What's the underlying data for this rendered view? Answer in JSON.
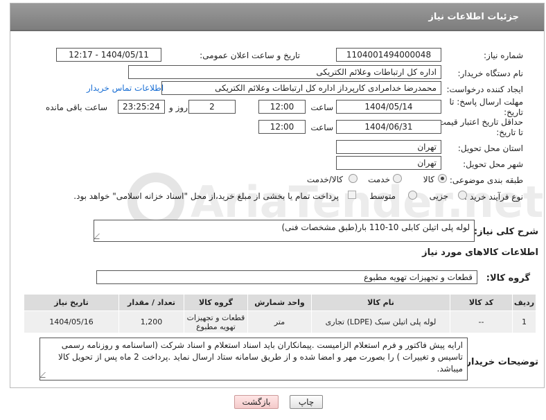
{
  "header": {
    "title": "جزئیات اطلاعات نیاز"
  },
  "fields": {
    "need_number_label": "شماره نیاز:",
    "need_number": "1104001494000048",
    "announce_label": "تاریخ و ساعت اعلان عمومی:",
    "announce_value": "1404/05/11 - 12:17",
    "buyer_org_label": "نام دستگاه خریدار:",
    "buyer_org": "اداره کل ارتباطات وعلائم الکتریکی",
    "requester_label": "ایجاد کننده درخواست:",
    "requester": "محمدرضا خدامرادی کارپرداز اداره کل ارتباطات وعلائم الکتریکی",
    "contact_link": "اطلاعات تماس خریدار",
    "reply_deadline_label_1": "مهلت ارسال پاسخ: تا",
    "reply_deadline_label_2": "تاریخ:",
    "reply_date": "1404/05/14",
    "time_label": "ساعت",
    "reply_time": "12:00",
    "days_value": "2",
    "days_label": "روز و",
    "remaining_time": "23:25:24",
    "remaining_label": "ساعت باقی مانده",
    "price_validity_label_1": "حداقل تاریخ اعتبار قیمت:",
    "price_validity_label_2": "تا تاریخ:",
    "price_date": "1404/06/31",
    "price_time": "12:00",
    "province_label": "استان محل تحویل:",
    "province": "تهران",
    "city_label": "شهر محل تحویل:",
    "city": "تهران",
    "category_label": "طبقه بندی موضوعی:",
    "category_options": [
      "کالا",
      "خدمت",
      "کالا/خدمت"
    ],
    "process_label": "نوع فرآیند خرید :",
    "process_options": [
      "جزیی",
      "متوسط"
    ],
    "payment_note": "پرداخت تمام یا بخشی از مبلغ خرید،از محل \"اسناد خزانه اسلامی\" خواهد بود."
  },
  "description": {
    "label": "شرح کلی نیاز:",
    "value": "لوله پلی اتیلن کابلی 10-110 بار(طبق مشخصات فنی)"
  },
  "goods_section_title": "اطلاعات کالاهای مورد نیاز",
  "goods_group": {
    "label": "گروه کالا:",
    "value": "قطعات و تجهیزات تهویه مطبوع"
  },
  "table": {
    "headers": [
      "ردیف",
      "کد کالا",
      "نام کالا",
      "واحد شمارش",
      "گروه کالا",
      "تعداد / مقدار",
      "تاریخ نیاز"
    ],
    "rows": [
      [
        "1",
        "--",
        "لوله پلی اتیلن سبک (LDPE) تجاری",
        "متر",
        "قطعات و تجهیزات تهویه مطبوع",
        "1,200",
        "1404/05/16"
      ]
    ]
  },
  "buyer_notes": {
    "label": "توضیحات خریدار:",
    "value": "ارایه پیش فاکتور و فرم استعلام الزامیست .پیمانکاران باید اسناد استعلام و اسناد شرکت (اساسنامه و روزنامه رسمی تاسیس و تغییرات ) را بصورت مهر و امضا شده و از طریق سامانه ستاد ارسال نماید .پرداخت 2 ماه پس از تحویل کالا میباشد."
  },
  "buttons": {
    "print": "چاپ",
    "back": "بازگشت"
  },
  "watermark_text": "AriaTender.net",
  "colors": {
    "header": "#8a8a8a",
    "link": "#1a6fd4",
    "back_button": "#f4caca"
  }
}
